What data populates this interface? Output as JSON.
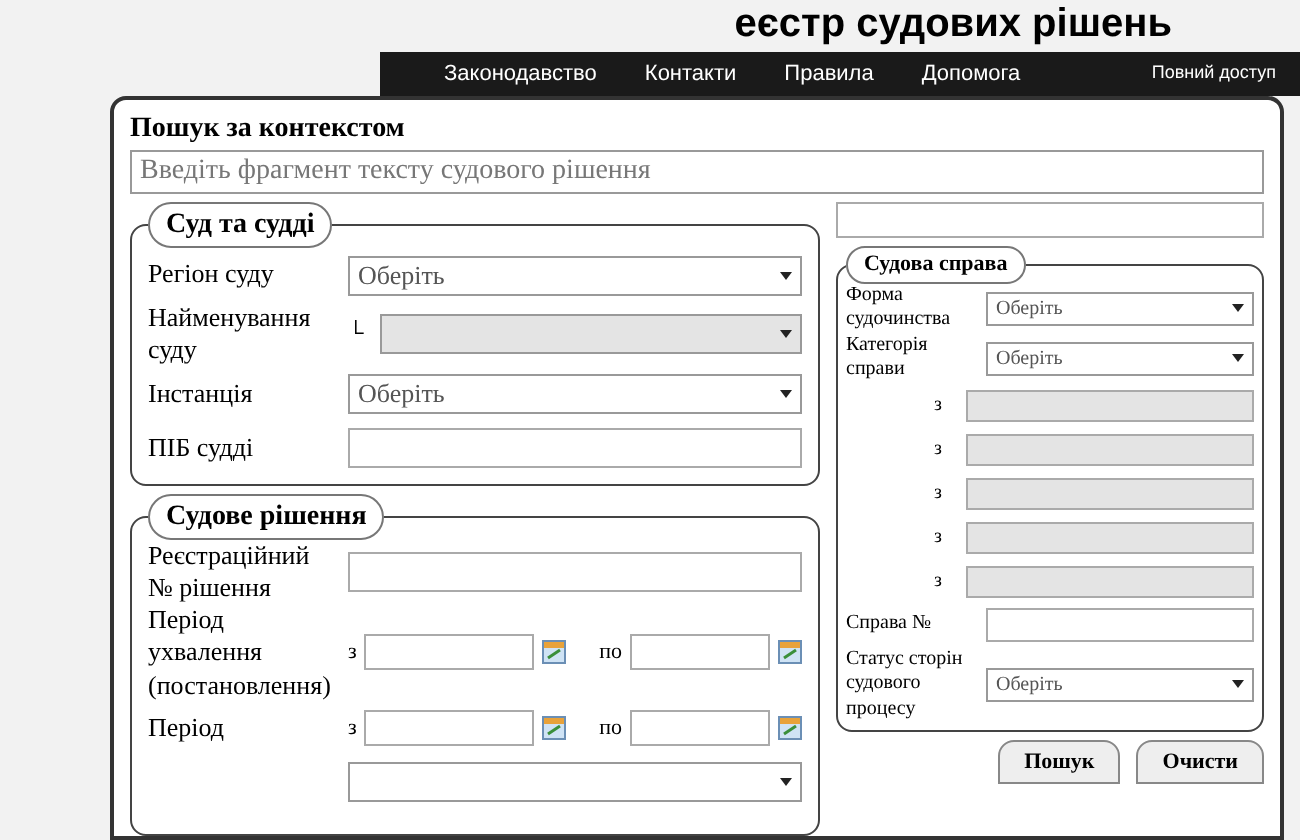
{
  "header": {
    "title": "еєстр судових рішень",
    "nav": [
      "Законодавство",
      "Контакти",
      "Правила",
      "Допомога"
    ],
    "full_access": "Повний доступ"
  },
  "context_search": {
    "label": "Пошук за контекстом",
    "placeholder": "Введіть фрагмент тексту судового рішення"
  },
  "court_section": {
    "title": "Суд та судді",
    "fields": [
      {
        "kind": "select",
        "label": "Регіон суду",
        "value": "Оберіть",
        "disabled": false
      },
      {
        "kind": "select",
        "label": "Найменування суду",
        "prefix": "└",
        "disabled": true
      },
      {
        "kind": "select",
        "label": "Інстанція",
        "value": "Оберіть",
        "disabled": false
      },
      {
        "kind": "text",
        "label": "ПІБ судді"
      }
    ]
  },
  "decision_section": {
    "title": "Судове рішення",
    "fields": [
      {
        "kind": "text",
        "label": "Реєстраційний № рішення"
      },
      {
        "kind": "period",
        "label": "Період ухвалення (постановлення)",
        "from": "з",
        "to": "по"
      },
      {
        "kind": "period",
        "label": "Період",
        "from": "з",
        "to": "по"
      },
      {
        "kind": "select",
        "disabled": false
      }
    ]
  },
  "case_section": {
    "title": "Судова справа",
    "fields": [
      {
        "kind": "select",
        "label": "Форма судочинства",
        "value": "Оберіть",
        "disabled": false
      },
      {
        "kind": "select",
        "label": "Категорія справи",
        "value": "Оберіть",
        "disabled": false
      },
      {
        "kind": "sub",
        "prefix": "з",
        "disabled": true
      },
      {
        "kind": "sub",
        "prefix": "з",
        "disabled": true
      },
      {
        "kind": "sub",
        "prefix": "з",
        "disabled": true
      },
      {
        "kind": "sub",
        "prefix": "з",
        "disabled": true
      },
      {
        "kind": "sub",
        "prefix": "з",
        "disabled": true
      },
      {
        "kind": "text",
        "label": "Справа №"
      },
      {
        "kind": "select",
        "label": "Статус сторін судового процесу",
        "value": "Оберіть",
        "disabled": false
      }
    ]
  },
  "buttons": [
    "Пошук",
    "Очисти"
  ]
}
